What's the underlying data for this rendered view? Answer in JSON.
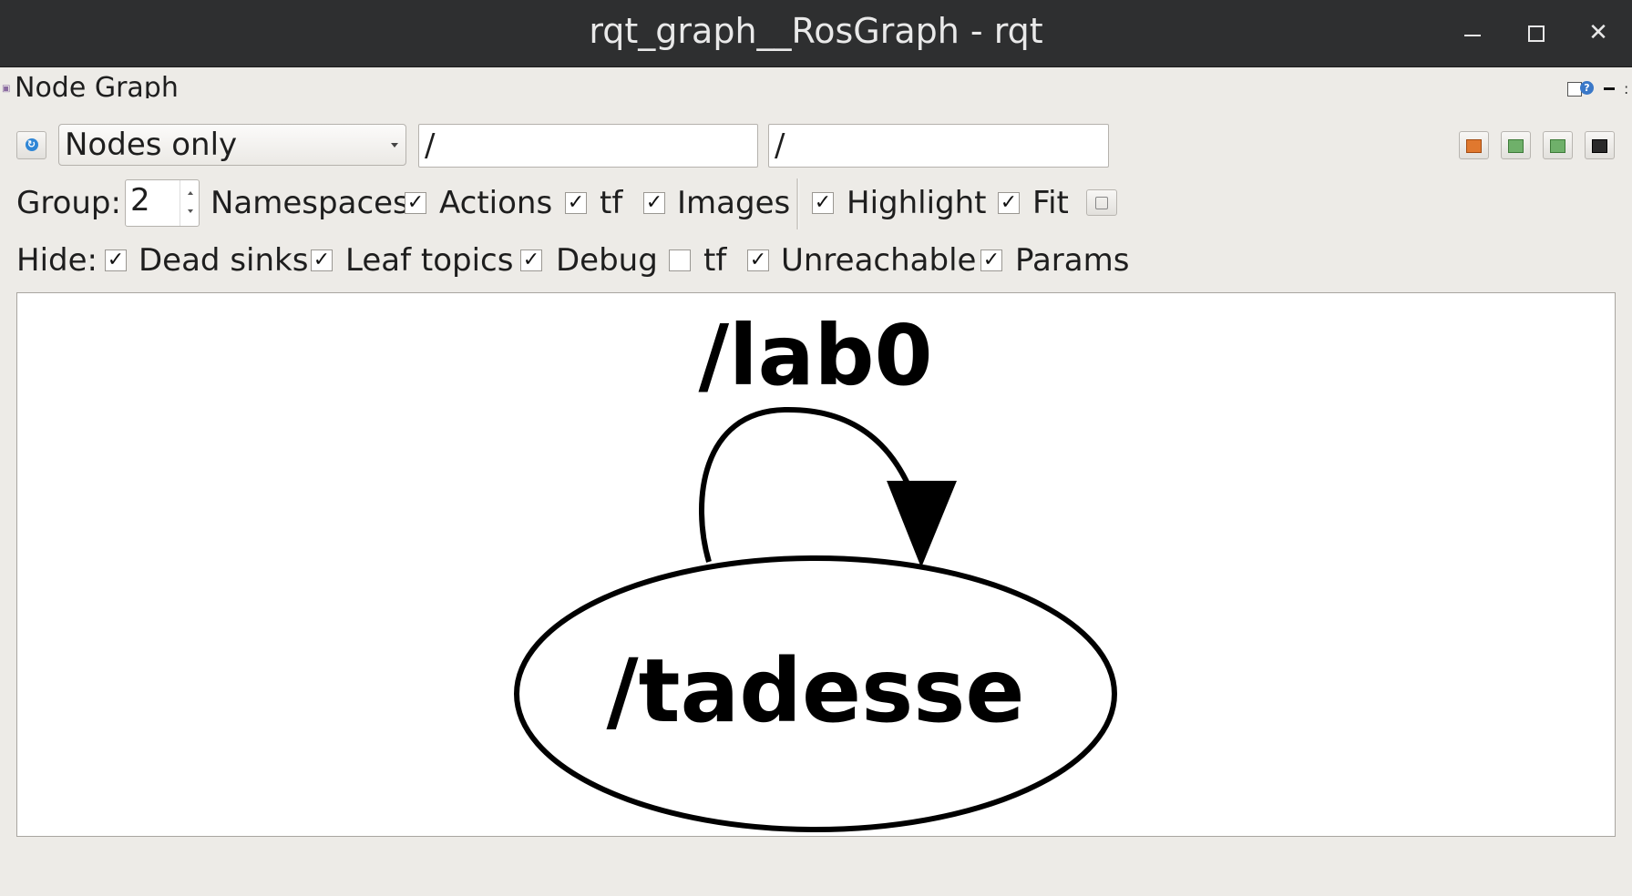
{
  "window": {
    "title": "rqt_graph__RosGraph - rqt"
  },
  "dock": {
    "title": "Node Graph"
  },
  "toolbar": {
    "mode": "Nodes only",
    "filter_nodes": "/",
    "filter_topics": "/"
  },
  "group_row": {
    "group_label": "Group:",
    "group_value": "2",
    "namespaces": {
      "label": "Namespaces",
      "checked": true
    },
    "actions": {
      "label": "Actions",
      "checked": true
    },
    "tf": {
      "label": "tf",
      "checked": true
    },
    "images": {
      "label": "Images",
      "checked": false
    },
    "highlight": {
      "label": "Highlight",
      "checked": true
    },
    "fit": {
      "label": "Fit",
      "checked": true
    }
  },
  "hide_row": {
    "hide_label": "Hide:",
    "dead_sinks": {
      "label": "Dead sinks",
      "checked": true
    },
    "leaf_topics": {
      "label": "Leaf topics",
      "checked": true
    },
    "debug": {
      "label": "Debug",
      "checked": true
    },
    "tf": {
      "label": "tf",
      "checked": false
    },
    "unreachable": {
      "label": "Unreachable",
      "checked": true
    },
    "params": {
      "label": "Params",
      "checked": true
    }
  },
  "graph": {
    "nodes": [
      {
        "label": "/lab0"
      },
      {
        "label": "/tadesse"
      }
    ]
  },
  "check_glyph": "✓"
}
